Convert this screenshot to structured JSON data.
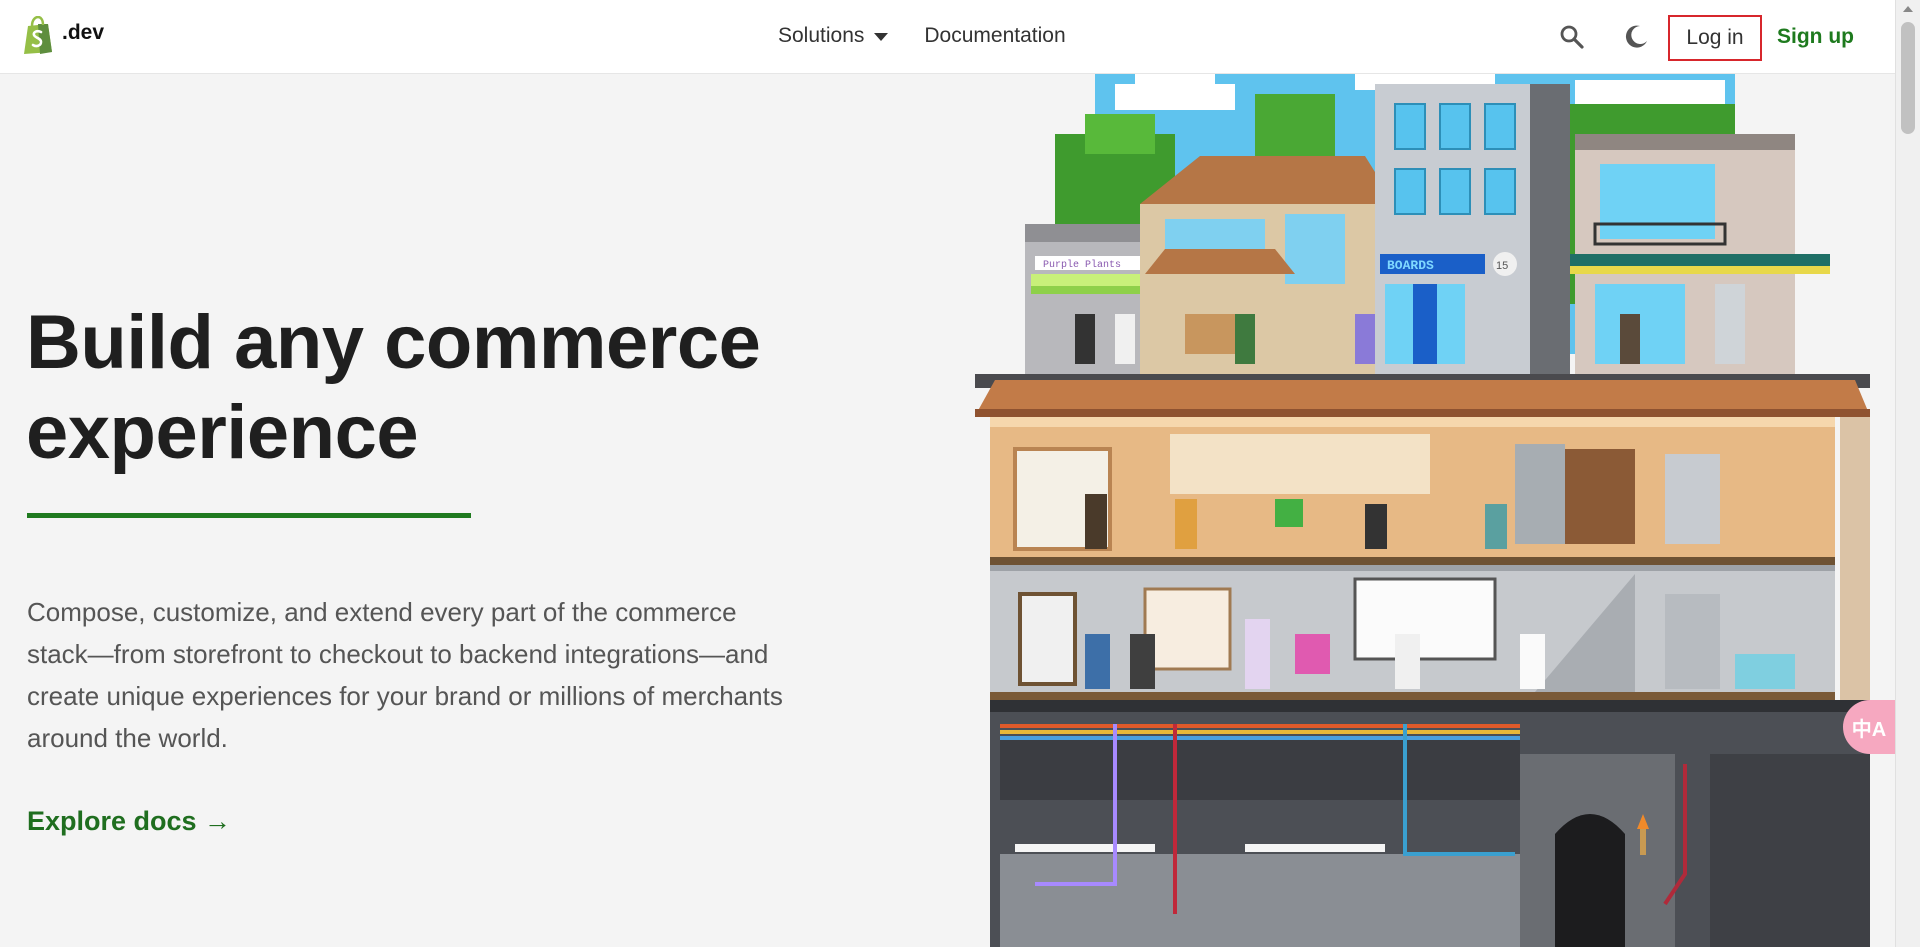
{
  "nav": {
    "logo_text": ".dev",
    "solutions_label": "Solutions",
    "documentation_label": "Documentation",
    "login_label": "Log in",
    "signup_label": "Sign up",
    "icons": [
      "shopify-bag-icon",
      "search-icon",
      "moon-icon",
      "chevron-down-icon"
    ]
  },
  "hero": {
    "title": "Build any commerce experience",
    "description": "Compose, customize, and extend every part of the commerce stack—from storefront to checkout to backend integrations—and create unique experiences for your brand or millions of merchants around the world.",
    "cta_label": "Explore docs →"
  },
  "illustration": {
    "sign_store": "Purple Plants",
    "sign_boards": "BOARDS",
    "building_number": "15"
  },
  "translate_label": "中A",
  "colors": {
    "brand_green": "#1f7a1f",
    "login_outline": "#d7262c",
    "background": "#f4f4f4"
  }
}
